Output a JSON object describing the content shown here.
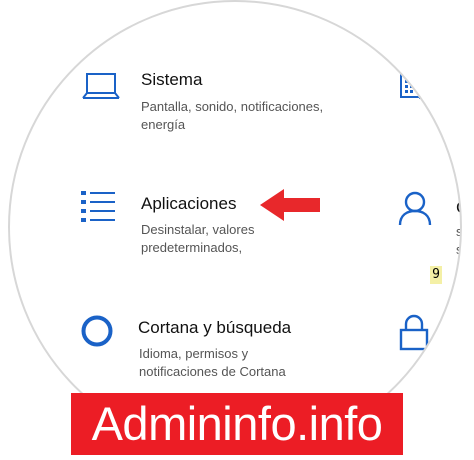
{
  "colors": {
    "accent_blue": "#1a62c7",
    "arrow_red": "#e8282b",
    "banner_red": "#ec1d25",
    "badge_yellow": "#f4f0a6"
  },
  "tiles": [
    {
      "id": "sistema",
      "icon": "laptop-icon",
      "title": "Sistema",
      "desc_line1": "Pantalla, sonido, notificaciones,",
      "desc_line2": "energía"
    },
    {
      "id": "aplicaciones",
      "icon": "apps-list-icon",
      "title": "Aplicaciones",
      "desc_line1": "Desinstalar, valores",
      "desc_line2": "predeterminados,"
    },
    {
      "id": "cortana",
      "icon": "cortana-circle-icon",
      "title": "Cortana y búsqueda",
      "desc_line1": "Idioma, permisos y",
      "desc_line2": "notificaciones de Cortana"
    }
  ],
  "right_column": {
    "account_title_partial": "C",
    "account_desc_line1_partial": "s",
    "account_desc_line2_partial": "si",
    "badge": "9"
  },
  "banner": {
    "text": "Admininfo.info"
  }
}
